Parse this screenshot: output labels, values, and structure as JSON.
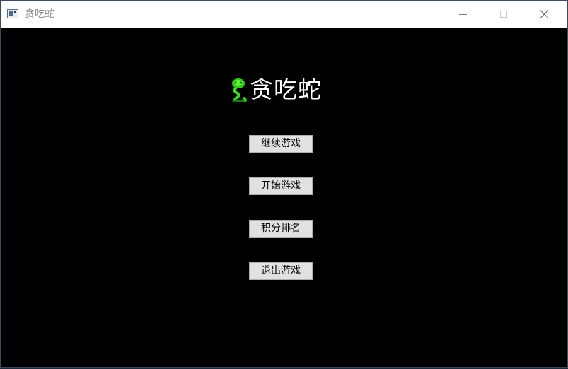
{
  "window": {
    "title": "贪吃蛇",
    "icon": "app-window-icon",
    "controls": [
      "minimize-icon",
      "maximize-icon",
      "close-icon"
    ]
  },
  "game": {
    "title": "贪吃蛇",
    "title_icon": "snake-icon",
    "background_color": "#000000",
    "title_color": "#ffffff"
  },
  "menu": {
    "continue_label": "继续游戏",
    "start_label": "开始游戏",
    "rank_label": "积分排名",
    "exit_label": "退出游戏"
  }
}
